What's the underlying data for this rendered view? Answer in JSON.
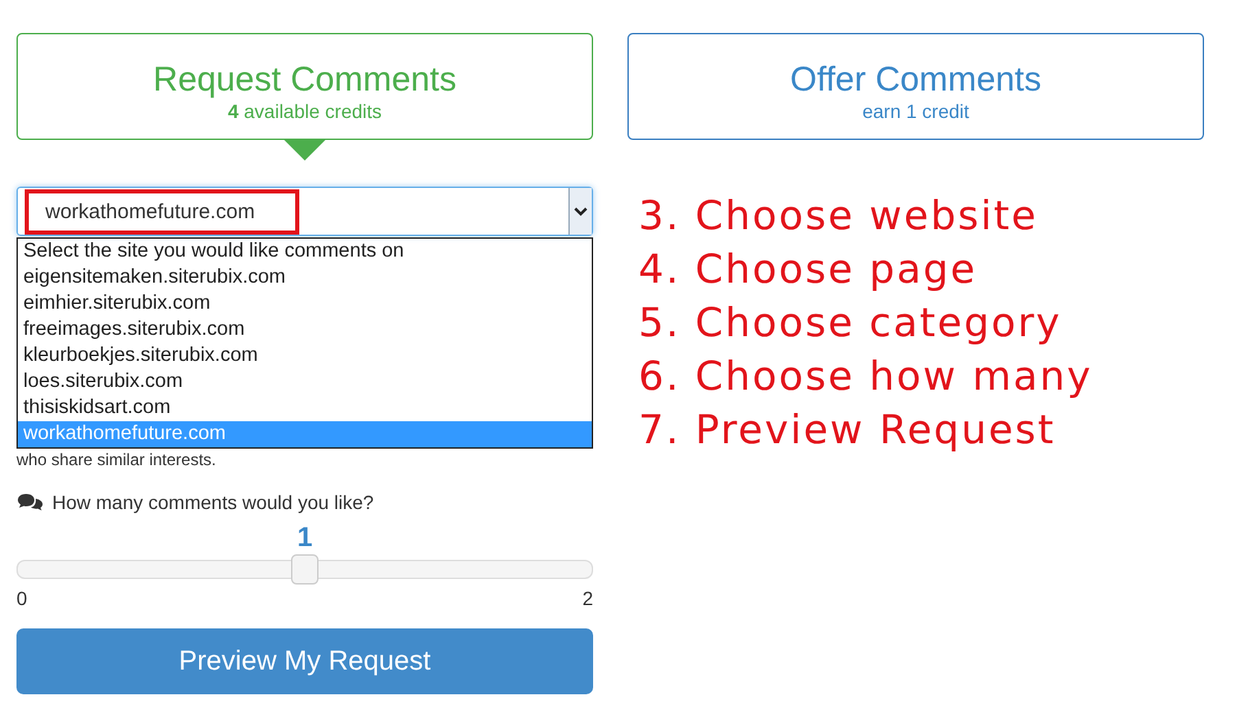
{
  "cards": [
    {
      "title": "Request Comments",
      "subtitle": "**4** available credits",
      "selected": true
    },
    {
      "title": "Offer Comments",
      "subtitle": "earn 1 credit",
      "selected": false
    }
  ],
  "site_select": {
    "value": "workathomefuture.com",
    "highlighted": true
  },
  "dropdown_options": [
    {
      "label": "Select the site you would like comments on",
      "selected": false
    },
    {
      "label": "eigensitemaken.siterubix.com",
      "selected": false
    },
    {
      "label": "eimhier.siterubix.com",
      "selected": false
    },
    {
      "label": "freeimages.siterubix.com",
      "selected": false
    },
    {
      "label": "kleurboekjes.siterubix.com",
      "selected": false
    },
    {
      "label": "loes.siterubix.com",
      "selected": false
    },
    {
      "label": "thisiskidsart.com",
      "selected": false
    },
    {
      "label": "workathomefuture.com",
      "selected": true
    }
  ],
  "hint": "who share similar interests.",
  "comments": {
    "question": "How many comments would you like?",
    "value": "1",
    "level": 0.5,
    "min": "0",
    "max": "2"
  },
  "button": "Preview My Request",
  "steps": [
    "3. Choose website",
    "4. Choose page",
    "5. Choose category",
    "6. Choose how many",
    "7. Preview Request"
  ]
}
